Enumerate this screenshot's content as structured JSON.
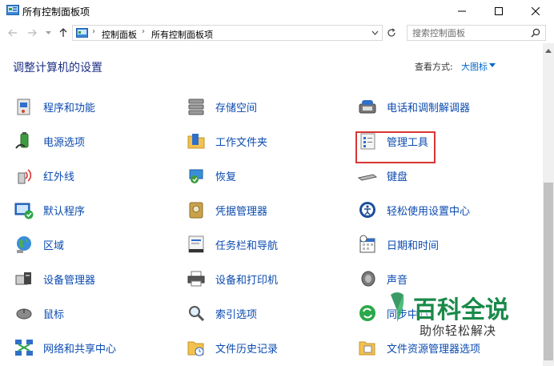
{
  "window": {
    "title": "所有控制面板项"
  },
  "address": {
    "crumbs": [
      "控制面板",
      "所有控制面板项"
    ]
  },
  "search": {
    "placeholder": "搜索控制面板"
  },
  "header": {
    "heading": "调整计算机的设置",
    "viewby_label": "查看方式:",
    "viewby_value": "大图标"
  },
  "items": {
    "col1": [
      {
        "label": "程序和功能",
        "icon": "programs-icon"
      },
      {
        "label": "电源选项",
        "icon": "power-icon"
      },
      {
        "label": "红外线",
        "icon": "infrared-icon"
      },
      {
        "label": "默认程序",
        "icon": "default-programs-icon"
      },
      {
        "label": "区域",
        "icon": "region-icon"
      },
      {
        "label": "设备管理器",
        "icon": "device-manager-icon"
      },
      {
        "label": "鼠标",
        "icon": "mouse-icon"
      },
      {
        "label": "网络和共享中心",
        "icon": "network-icon"
      }
    ],
    "col2": [
      {
        "label": "存储空间",
        "icon": "storage-icon"
      },
      {
        "label": "工作文件夹",
        "icon": "work-folders-icon"
      },
      {
        "label": "恢复",
        "icon": "recovery-icon"
      },
      {
        "label": "凭据管理器",
        "icon": "credential-icon"
      },
      {
        "label": "任务栏和导航",
        "icon": "taskbar-icon"
      },
      {
        "label": "设备和打印机",
        "icon": "printer-icon"
      },
      {
        "label": "索引选项",
        "icon": "indexing-icon"
      },
      {
        "label": "文件历史记录",
        "icon": "file-history-icon"
      }
    ],
    "col3": [
      {
        "label": "电话和调制解调器",
        "icon": "phone-modem-icon"
      },
      {
        "label": "管理工具",
        "icon": "admin-tools-icon"
      },
      {
        "label": "键盘",
        "icon": "keyboard-icon"
      },
      {
        "label": "轻松使用设置中心",
        "icon": "ease-of-access-icon"
      },
      {
        "label": "日期和时间",
        "icon": "datetime-icon"
      },
      {
        "label": "声音",
        "icon": "sound-icon"
      },
      {
        "label": "同步中心",
        "icon": "sync-icon"
      },
      {
        "label": "文件资源管理器选项",
        "icon": "explorer-options-icon"
      }
    ]
  },
  "watermark": {
    "title": "百科全说",
    "subtitle": "助你轻松解决"
  }
}
